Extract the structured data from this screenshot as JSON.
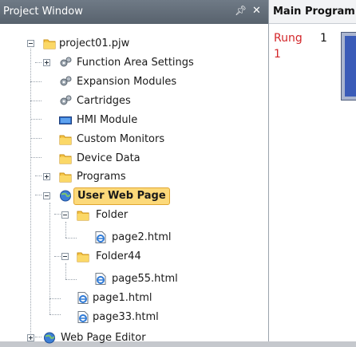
{
  "project_window": {
    "title": "Project Window",
    "pin_icon": "pin-icon",
    "close_icon": "close-icon",
    "tree": [
      {
        "id": "project",
        "label": "project01.pjw",
        "icon": "folder-icon",
        "expander": "minus"
      },
      {
        "id": "function-area-settings",
        "label": "Function Area Settings",
        "icon": "gears-icon",
        "expander": "plus"
      },
      {
        "id": "expansion-modules",
        "label": "Expansion Modules",
        "icon": "gears-icon",
        "expander": "none"
      },
      {
        "id": "cartridges",
        "label": "Cartridges",
        "icon": "gears-icon",
        "expander": "none"
      },
      {
        "id": "hmi-module",
        "label": "HMI Module",
        "icon": "hmi-icon",
        "expander": "none"
      },
      {
        "id": "custom-monitors",
        "label": "Custom Monitors",
        "icon": "folder-icon",
        "expander": "none"
      },
      {
        "id": "device-data",
        "label": "Device Data",
        "icon": "folder-icon",
        "expander": "none"
      },
      {
        "id": "programs",
        "label": "Programs",
        "icon": "folder-icon",
        "expander": "plus"
      },
      {
        "id": "user-web-page",
        "label": "User Web Page",
        "icon": "globe-icon",
        "expander": "minus",
        "selected": true
      },
      {
        "id": "folder",
        "label": "Folder",
        "icon": "folder-icon",
        "expander": "minus"
      },
      {
        "id": "page2",
        "label": "page2.html",
        "icon": "html-page-icon",
        "expander": "none"
      },
      {
        "id": "folder44",
        "label": "Folder44",
        "icon": "folder-icon",
        "expander": "minus"
      },
      {
        "id": "page55",
        "label": "page55.html",
        "icon": "html-page-icon",
        "expander": "none"
      },
      {
        "id": "page1",
        "label": "page1.html",
        "icon": "html-page-icon",
        "expander": "none"
      },
      {
        "id": "page33",
        "label": "page33.html",
        "icon": "html-page-icon",
        "expander": "none"
      },
      {
        "id": "web-page-editor",
        "label": "Web Page Editor",
        "icon": "globe-icon",
        "expander": "plus"
      }
    ]
  },
  "main_program": {
    "tab_label": "Main Program",
    "rung_label": "Rung",
    "rung_number": "1",
    "rung_sub": "1"
  },
  "colors": {
    "header": "#5f6a75",
    "selection": "#fcd97a",
    "rung_text": "#d3262a"
  }
}
